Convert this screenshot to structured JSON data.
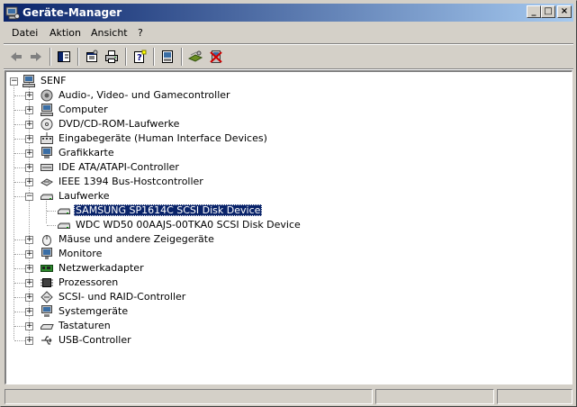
{
  "window": {
    "title": "Geräte-Manager",
    "controls": {
      "minimize": "_",
      "maximize": "□",
      "close": "×"
    }
  },
  "menu": [
    {
      "label": "Datei"
    },
    {
      "label": "Aktion"
    },
    {
      "label": "Ansicht"
    },
    {
      "label": "?"
    }
  ],
  "toolbar": [
    {
      "icon": "back-arrow-icon"
    },
    {
      "icon": "forward-arrow-icon"
    },
    {
      "icon": "show-hide-console-tree-icon"
    },
    {
      "icon": "properties-icon"
    },
    {
      "icon": "print-icon"
    },
    {
      "icon": "help-icon"
    },
    {
      "icon": "update-driver-icon"
    },
    {
      "icon": "scan-hardware-icon"
    },
    {
      "icon": "uninstall-icon"
    }
  ],
  "tree": {
    "root": {
      "label": "SENF",
      "icon": "computer-icon",
      "expanded": true
    },
    "categories": [
      {
        "label": "Audio-, Video- und Gamecontroller",
        "icon": "speaker-icon"
      },
      {
        "label": "Computer",
        "icon": "computer-icon"
      },
      {
        "label": "DVD/CD-ROM-Laufwerke",
        "icon": "cd-drive-icon"
      },
      {
        "label": "Eingabegeräte (Human Interface Devices)",
        "icon": "hid-icon"
      },
      {
        "label": "Grafikkarte",
        "icon": "display-adapter-icon"
      },
      {
        "label": "IDE ATA/ATAPI-Controller",
        "icon": "ide-controller-icon"
      },
      {
        "label": "IEEE 1394 Bus-Hostcontroller",
        "icon": "firewire-icon"
      },
      {
        "label": "Laufwerke",
        "icon": "disk-drive-icon",
        "expanded": true,
        "children": [
          {
            "label": "SAMSUNG SP1614C SCSI Disk Device",
            "icon": "disk-drive-icon",
            "selected": true
          },
          {
            "label": "WDC WD50 00AAJS-00TKA0 SCSI Disk Device",
            "icon": "disk-drive-icon"
          }
        ]
      },
      {
        "label": "Mäuse und andere Zeigegeräte",
        "icon": "mouse-icon"
      },
      {
        "label": "Monitore",
        "icon": "monitor-icon"
      },
      {
        "label": "Netzwerkadapter",
        "icon": "network-adapter-icon"
      },
      {
        "label": "Prozessoren",
        "icon": "processor-icon"
      },
      {
        "label": "SCSI- und RAID-Controller",
        "icon": "scsi-controller-icon"
      },
      {
        "label": "Systemgeräte",
        "icon": "system-devices-icon"
      },
      {
        "label": "Tastaturen",
        "icon": "keyboard-icon"
      },
      {
        "label": "USB-Controller",
        "icon": "usb-icon"
      }
    ]
  },
  "statusbar": {
    "panels": [
      "",
      "",
      ""
    ]
  }
}
